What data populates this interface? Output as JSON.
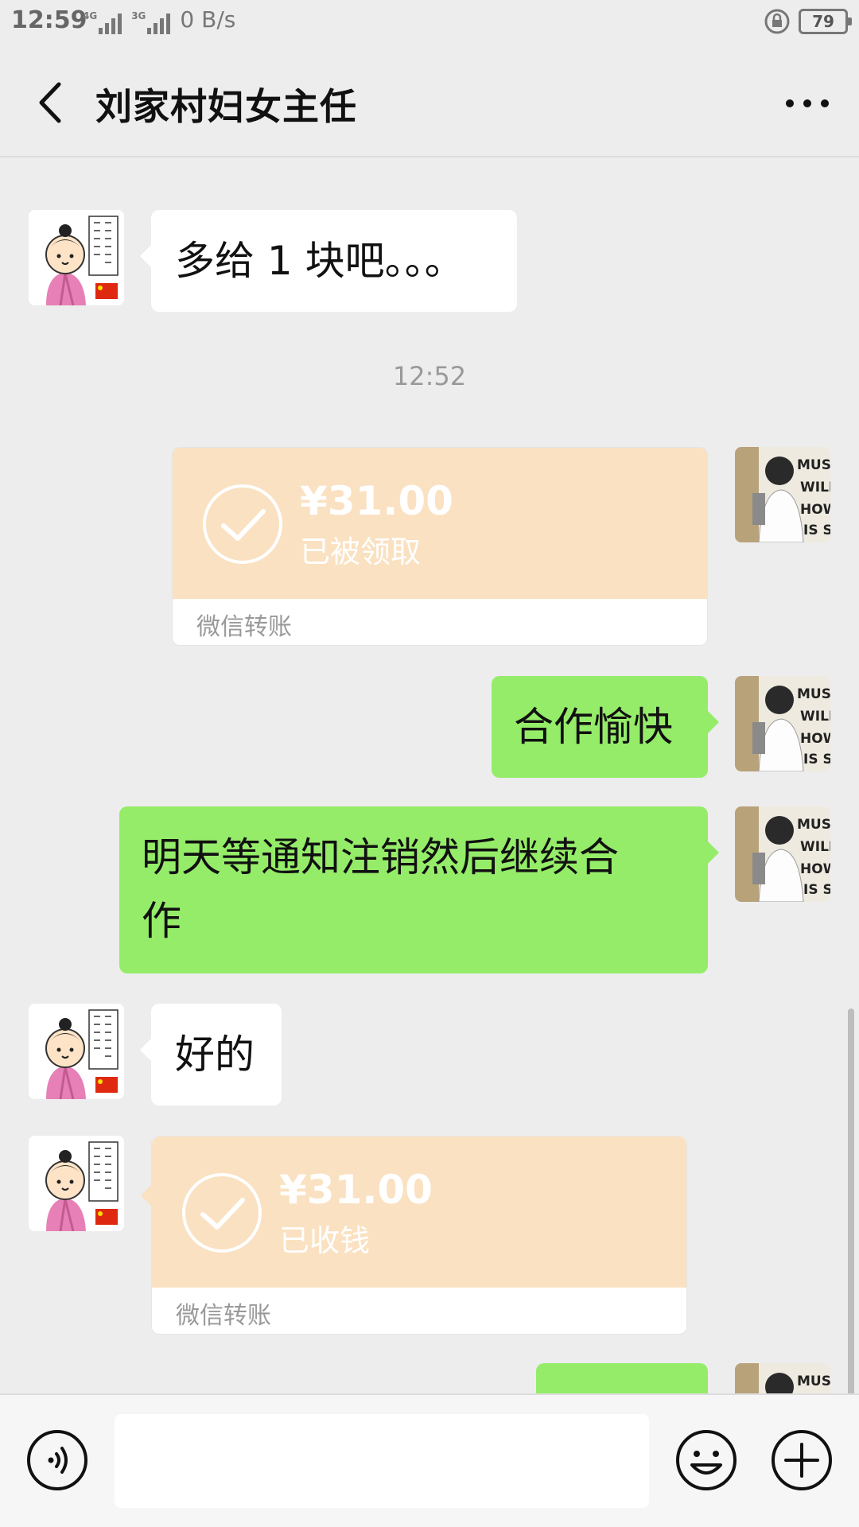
{
  "status_bar": {
    "time": "12:59",
    "network_1": "4G",
    "network_2": "3G",
    "speed": "0 B/s",
    "battery": "79"
  },
  "header": {
    "title": "刘家村妇女主任",
    "back_icon": "chevron-left-icon",
    "more_icon": "more-dots-icon"
  },
  "messages": [
    {
      "side": "left",
      "type": "text",
      "text": "多给 1 块吧。。。"
    },
    {
      "type": "timestamp",
      "text": "12:52"
    },
    {
      "side": "right",
      "type": "transfer",
      "amount": "¥31.00",
      "status": "已被领取",
      "footer": "微信转账"
    },
    {
      "side": "right",
      "type": "text",
      "text": "合作愉快"
    },
    {
      "side": "right",
      "type": "text",
      "text_line1": "明天等通知注销然后继续合",
      "text_line2": "作"
    },
    {
      "side": "left",
      "type": "text",
      "text": "好的"
    },
    {
      "side": "left",
      "type": "transfer",
      "amount": "¥31.00",
      "status": "已收钱",
      "footer": "微信转账"
    }
  ],
  "input_bar": {
    "input_value": "",
    "voice_icon": "voice-icon",
    "emoji_icon": "emoji-icon",
    "plus_icon": "plus-icon"
  },
  "colors": {
    "chat_bg": "#ededed",
    "green_bubble": "#95ec69",
    "transfer_bg": "#fae1c1"
  }
}
